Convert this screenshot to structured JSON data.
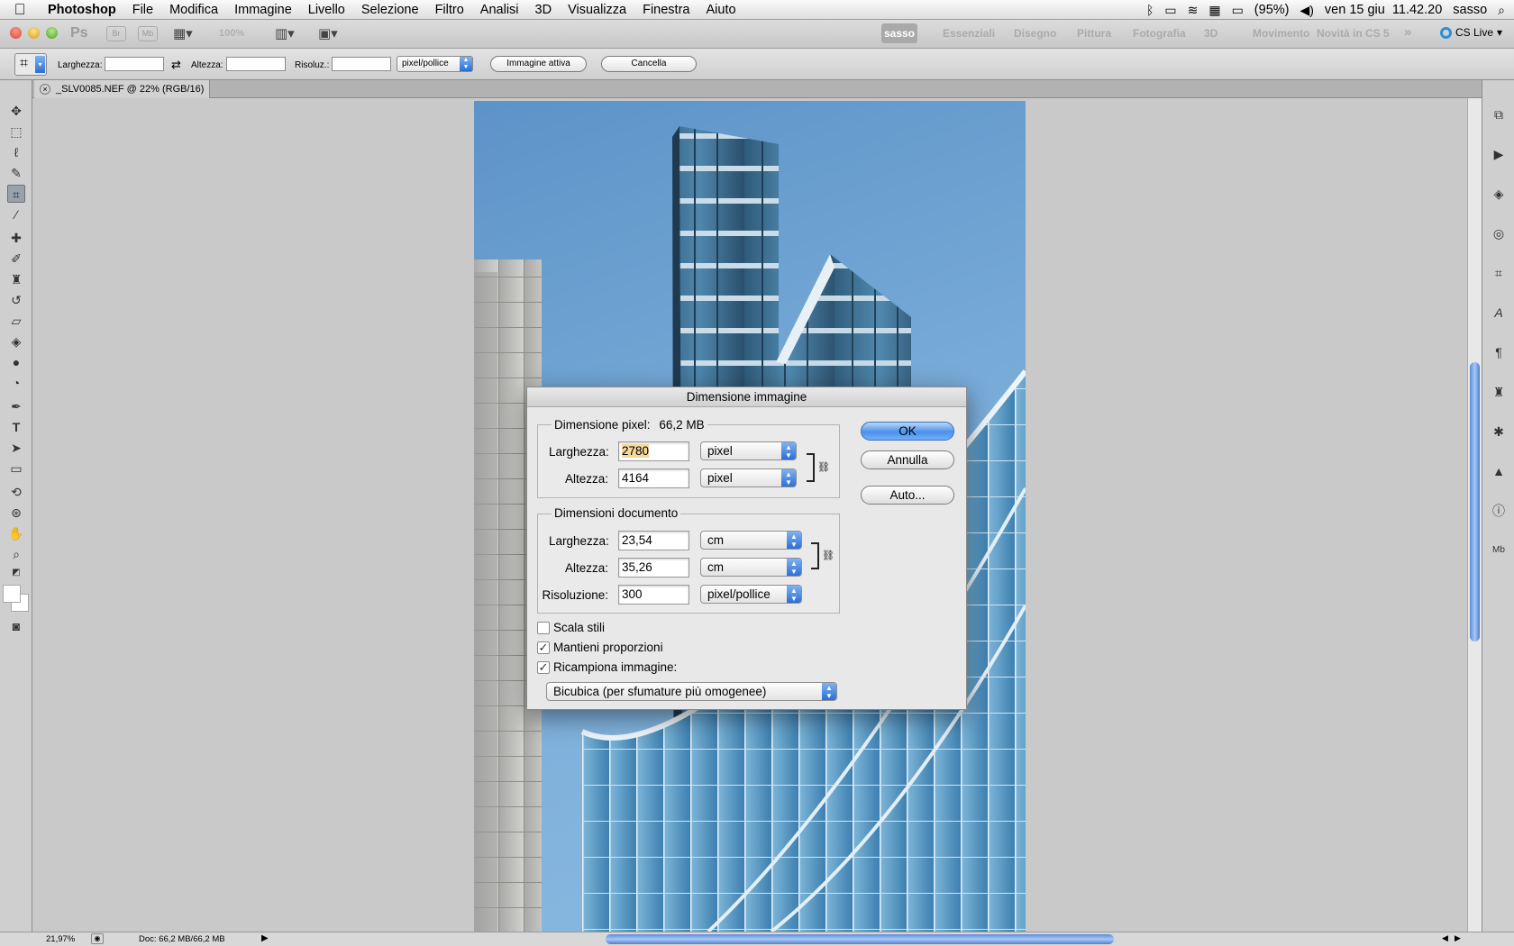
{
  "menubar": {
    "app": "Photoshop",
    "items": [
      "File",
      "Modifica",
      "Immagine",
      "Livello",
      "Selezione",
      "Filtro",
      "Analisi",
      "3D",
      "Visualizza",
      "Finestra",
      "Aiuto"
    ],
    "battery": "(95%)",
    "datetime": "ven 15 giu  11.42.20",
    "user": "sasso"
  },
  "appbar": {
    "ps_logo": "Ps",
    "br_label": "Br",
    "mb_label": "Mb",
    "zoom": "100%",
    "workspaces": [
      "sasso",
      "Essenziali",
      "Disegno",
      "Pittura",
      "Fotografia",
      "3D",
      "Movimento",
      "Novità in CS 5"
    ],
    "more": "»",
    "cslive": "CS Live"
  },
  "options": {
    "larghezza_label": "Larghezza:",
    "altezza_label": "Altezza:",
    "risoluz_label": "Risoluz.:",
    "unit": "pixel/pollice",
    "btn_active": "Immagine attiva",
    "btn_clear": "Cancella"
  },
  "doc_tab": {
    "title": "_SLV0085.NEF @ 22% (RGB/16) *"
  },
  "status": {
    "zoom": "21,97%",
    "doc": "Doc: 66,2 MB/66,2 MB"
  },
  "dialog": {
    "title": "Dimensione immagine",
    "pixel_group": "Dimensione pixel:",
    "pixel_size": "66,2 MB",
    "larghezza_label": "Larghezza:",
    "altezza_label": "Altezza:",
    "px_width": "2780",
    "px_height": "4164",
    "px_unit": "pixel",
    "doc_group": "Dimensioni documento",
    "doc_width": "23,54",
    "doc_height": "35,26",
    "doc_unit": "cm",
    "resolution_label": "Risoluzione:",
    "resolution": "300",
    "res_unit": "pixel/pollice",
    "scale_styles": "Scala stili",
    "constrain": "Mantieni proporzioni",
    "resample": "Ricampiona immagine:",
    "resample_method": "Bicubica (per sfumature più omogenee)",
    "ok": "OK",
    "cancel": "Annulla",
    "auto": "Auto..."
  }
}
